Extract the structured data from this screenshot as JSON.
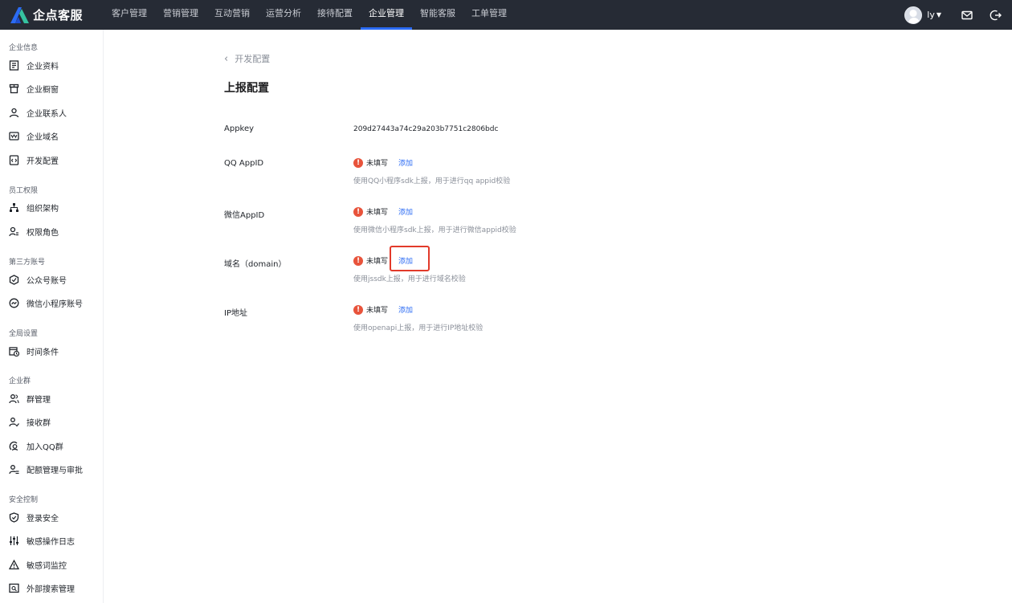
{
  "header": {
    "logo_text": "企点客服",
    "nav": [
      {
        "label": "客户管理"
      },
      {
        "label": "营销管理"
      },
      {
        "label": "互动营销"
      },
      {
        "label": "运营分析"
      },
      {
        "label": "接待配置"
      },
      {
        "label": "企业管理",
        "active": true
      },
      {
        "label": "智能客服"
      },
      {
        "label": "工单管理"
      }
    ],
    "user_name": "ly",
    "accent_color": "#2b6bf4",
    "icons": [
      "mail-icon",
      "logout-icon"
    ]
  },
  "sidebar": {
    "groups": [
      {
        "title": "企业信息",
        "items": [
          {
            "label": "企业资料",
            "icon": "document-icon"
          },
          {
            "label": "企业橱窗",
            "icon": "storefront-icon"
          },
          {
            "label": "企业联系人",
            "icon": "contact-icon"
          },
          {
            "label": "企业域名",
            "icon": "domain-icon"
          },
          {
            "label": "开发配置",
            "icon": "code-icon"
          }
        ]
      },
      {
        "title": "员工权限",
        "items": [
          {
            "label": "组织架构",
            "icon": "org-chart-icon"
          },
          {
            "label": "权限角色",
            "icon": "role-icon"
          }
        ]
      },
      {
        "title": "第三方账号",
        "items": [
          {
            "label": "公众号账号",
            "icon": "official-account-icon"
          },
          {
            "label": "微信小程序账号",
            "icon": "mini-program-icon"
          }
        ]
      },
      {
        "title": "全局设置",
        "items": [
          {
            "label": "时间条件",
            "icon": "calendar-clock-icon"
          }
        ]
      },
      {
        "title": "企业群",
        "items": [
          {
            "label": "群管理",
            "icon": "group-icon"
          },
          {
            "label": "接收群",
            "icon": "receive-group-icon"
          },
          {
            "label": "加入QQ群",
            "icon": "join-qq-group-icon"
          },
          {
            "label": "配额管理与审批",
            "icon": "quota-icon"
          }
        ]
      },
      {
        "title": "安全控制",
        "items": [
          {
            "label": "登录安全",
            "icon": "shield-icon"
          },
          {
            "label": "敏感操作日志",
            "icon": "sliders-icon"
          },
          {
            "label": "敏感词监控",
            "icon": "warning-icon"
          },
          {
            "label": "外部搜索管理",
            "icon": "search-manage-icon"
          }
        ]
      }
    ]
  },
  "main": {
    "back_label": "开发配置",
    "title": "上报配置",
    "appkey": {
      "label": "Appkey",
      "value": "209d27443a74c29a203b7751c2806bdc"
    },
    "rows": [
      {
        "label": "QQ AppID",
        "status": "未填写",
        "action": "添加",
        "hint": "使用QQ小程序sdk上报，用于进行qq appid校验"
      },
      {
        "label": "微信AppID",
        "status": "未填写",
        "action": "添加",
        "hint": "使用微信小程序sdk上报，用于进行微信appid校验"
      },
      {
        "label": "域名（domain）",
        "status": "未填写",
        "action": "添加",
        "hint": "使用jssdk上报，用于进行域名校验"
      },
      {
        "label": "IP地址",
        "status": "未填写",
        "action": "添加",
        "hint": "使用openapi上报，用于进行IP地址校验"
      }
    ],
    "error_color": "#e8533b",
    "highlight_color": "#e23a2a"
  }
}
